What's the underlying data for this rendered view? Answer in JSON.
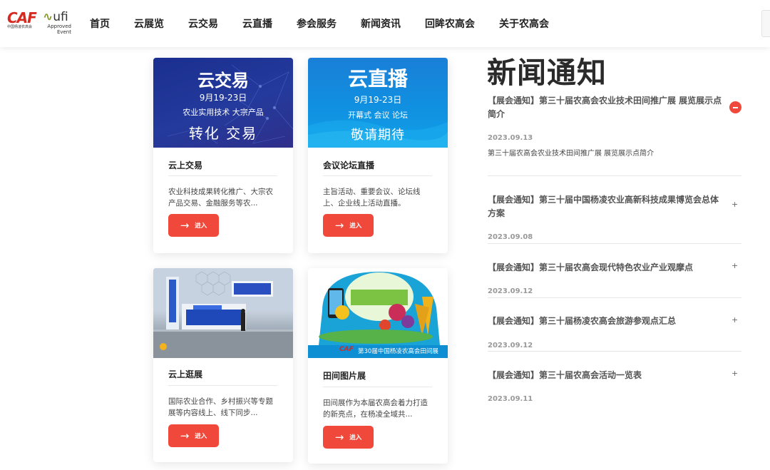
{
  "header": {
    "logo_caf": "CAF",
    "logo_caf_sub": "中国杨凌农高会",
    "logo_ufi": "ufi",
    "logo_ufi_sub1": "Approved",
    "logo_ufi_sub2": "Event",
    "nav": [
      "首页",
      "云展览",
      "云交易",
      "云直播",
      "参会服务",
      "新闻资讯",
      "回眸农高会",
      "关于农高会"
    ]
  },
  "cards": [
    {
      "banner": {
        "title": "云交易",
        "date": "9月19-23日",
        "line": "农业实用技术 大宗产品",
        "big": "转化 交易"
      },
      "title": "云上交易",
      "desc": "农业科技成果转化推广、大宗农产品交易、金融服务等农...",
      "button": "进入"
    },
    {
      "banner": {
        "title": "云直播",
        "date": "9月19-23日",
        "line": "开幕式 会议 论坛",
        "big": "敬请期待"
      },
      "title": "会议论坛直播",
      "desc": "主旨活动、重要会议、论坛线上、企业线上活动直播。",
      "button": "进入"
    },
    {
      "title": "云上逛展",
      "desc": "国际农业合作、乡村振兴等专题展等内容线上、线下同步...",
      "button": "进入"
    },
    {
      "banner": {
        "caption": "第30届中国杨凌农高会田间展",
        "caf": "CAF"
      },
      "title": "田间图片展",
      "desc": "田间展作为本届农高会着力打造的新亮点，在杨凌全域共...",
      "button": "进入"
    }
  ],
  "news": {
    "heading": "新闻通知",
    "items": [
      {
        "title": "【展会通知】第三十届农高会农业技术田间推广展 展览展示点简介",
        "date": "2023.09.13",
        "summary": "第三十届农高会农业技术田间推广展 展览展示点简介",
        "expanded": true
      },
      {
        "title": "【展会通知】第三十届中国杨凌农业高新科技成果博览会总体方案",
        "date": "2023.09.08",
        "expanded": false
      },
      {
        "title": "【展会通知】第三十届农高会现代特色农业产业观摩点",
        "date": "2023.09.12",
        "expanded": false
      },
      {
        "title": "【展会通知】第三十届杨凌农高会旅游参观点汇总",
        "date": "2023.09.12",
        "expanded": false
      },
      {
        "title": "【展会通知】第三十届农高会活动一览表",
        "date": "2023.09.11",
        "expanded": false
      }
    ]
  },
  "colors": {
    "accent": "#f0483a",
    "brand_red": "#d62a20"
  }
}
